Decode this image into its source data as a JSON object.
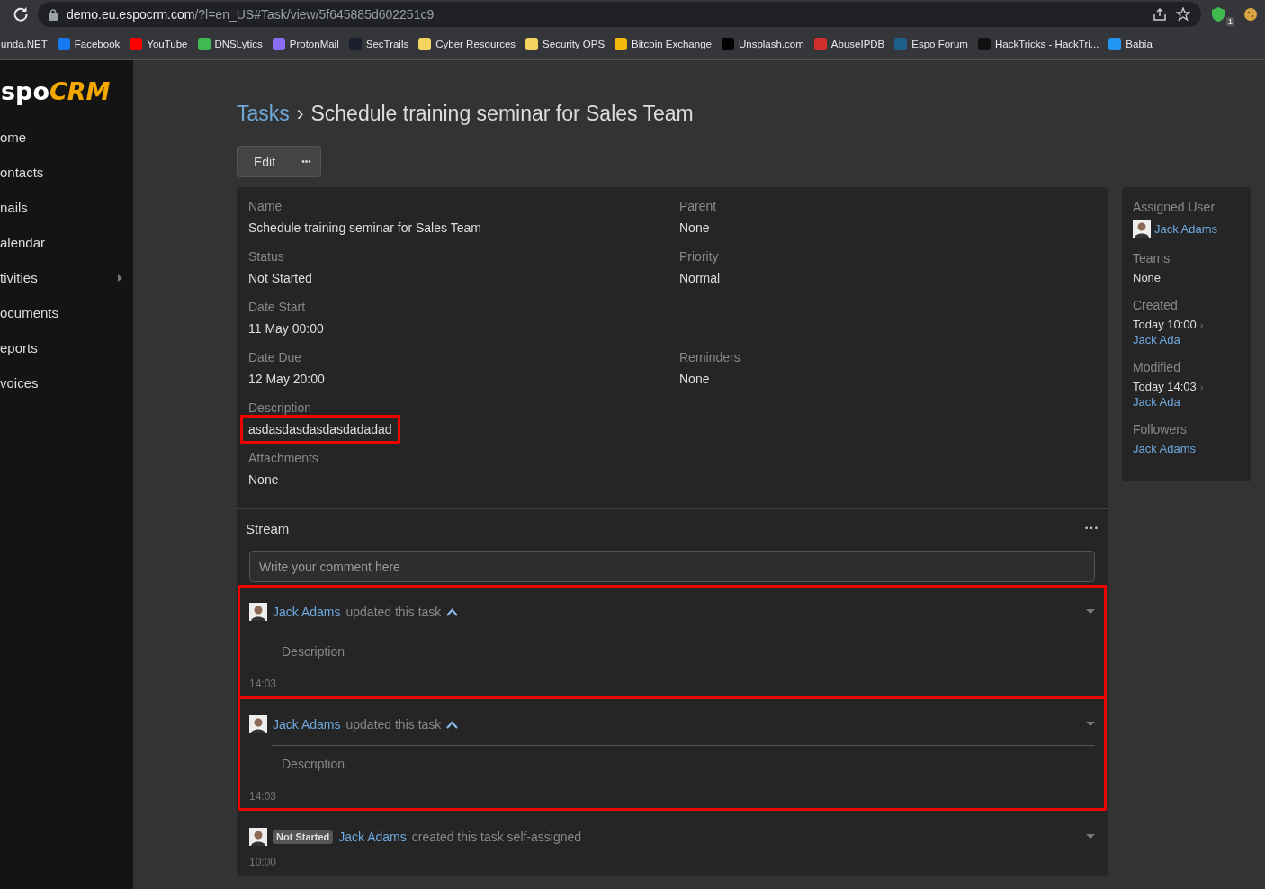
{
  "browser": {
    "url_host": "demo.eu.espocrm.com",
    "url_path": "/?l=en_US#Task/view/5f645885d602251c9",
    "extension_badge": "1"
  },
  "bookmarks": [
    {
      "label": "unda.NET"
    },
    {
      "label": "Facebook",
      "color": "#1877f2"
    },
    {
      "label": "YouTube",
      "color": "#ff0000"
    },
    {
      "label": "DNSLytics",
      "color": "#3fb950"
    },
    {
      "label": "ProtonMail",
      "color": "#8b6cf6"
    },
    {
      "label": "SecTrails",
      "color": "#1b1f2e"
    },
    {
      "label": "Cyber Resources",
      "color": "#f4d35e"
    },
    {
      "label": "Security OPS",
      "color": "#f4d35e"
    },
    {
      "label": "Bitcoin Exchange",
      "color": "#f0b90b"
    },
    {
      "label": "Unsplash.com",
      "color": "#000000"
    },
    {
      "label": "AbuseIPDB",
      "color": "#d32f2f"
    },
    {
      "label": "Espo Forum",
      "color": "#1e5f8a"
    },
    {
      "label": "HackTricks - HackTri...",
      "color": "#111111"
    },
    {
      "label": "Babia",
      "color": "#2196f3"
    }
  ],
  "logo": {
    "left": "spo",
    "right": "CRM"
  },
  "sidebar": {
    "items": [
      {
        "label": "ome",
        "has_submenu": false
      },
      {
        "label": "ontacts",
        "has_submenu": false
      },
      {
        "label": "nails",
        "has_submenu": false
      },
      {
        "label": "alendar",
        "has_submenu": false
      },
      {
        "label": "tivities",
        "has_submenu": true
      },
      {
        "label": "ocuments",
        "has_submenu": false
      },
      {
        "label": "eports",
        "has_submenu": false
      },
      {
        "label": "voices",
        "has_submenu": false
      }
    ]
  },
  "breadcrumb": {
    "parent": "Tasks",
    "separator": "›",
    "title": "Schedule training seminar for Sales Team"
  },
  "actions": {
    "edit": "Edit",
    "more": "•••"
  },
  "detail": {
    "rows": [
      [
        {
          "label": "Name",
          "value": "Schedule training seminar for Sales Team",
          "highlighted": false
        },
        {
          "label": "Parent",
          "value": "None",
          "highlighted": false
        }
      ],
      [
        {
          "label": "Status",
          "value": "Not Started",
          "highlighted": false
        },
        {
          "label": "Priority",
          "value": "Normal",
          "highlighted": false
        }
      ],
      [
        {
          "label": "Date Start",
          "value": "11 May 00:00",
          "highlighted": false
        }
      ],
      [
        {
          "label": "Date Due",
          "value": "12 May 20:00",
          "highlighted": false
        },
        {
          "label": "Reminders",
          "value": "None",
          "highlighted": false
        }
      ],
      [
        {
          "label": "Description",
          "value": "asdasdasdasdasdadadad",
          "highlighted": true
        }
      ],
      [
        {
          "label": "Attachments",
          "value": "None",
          "highlighted": false
        }
      ]
    ]
  },
  "side": {
    "fields": [
      {
        "label": "Assigned User",
        "kind": "user",
        "value": "Jack Adams"
      },
      {
        "label": "Teams",
        "kind": "plain",
        "value": "None"
      },
      {
        "label": "Created",
        "kind": "dated",
        "value": "Today 10:00",
        "separator": "›",
        "user": "Jack Ada"
      },
      {
        "label": "Modified",
        "kind": "dated",
        "value": "Today 14:03",
        "separator": "›",
        "user": "Jack Ada"
      },
      {
        "label": "Followers",
        "kind": "link",
        "value": "Jack Adams"
      }
    ]
  },
  "stream": {
    "title": "Stream",
    "menu": "•••",
    "comment_placeholder": "Write your comment here",
    "entries": [
      {
        "kind": "update",
        "user": "Jack Adams",
        "action": "updated this task",
        "expanded": true,
        "detail": "Description",
        "time": "14:03",
        "highlighted": true
      },
      {
        "kind": "update",
        "user": "Jack Adams",
        "action": "updated this task",
        "expanded": true,
        "detail": "Description",
        "time": "14:03",
        "highlighted": true
      },
      {
        "kind": "create",
        "badge": "Not Started",
        "user": "Jack Adams",
        "action": "created this task self-assigned",
        "time": "10:00",
        "highlighted": false
      }
    ]
  }
}
